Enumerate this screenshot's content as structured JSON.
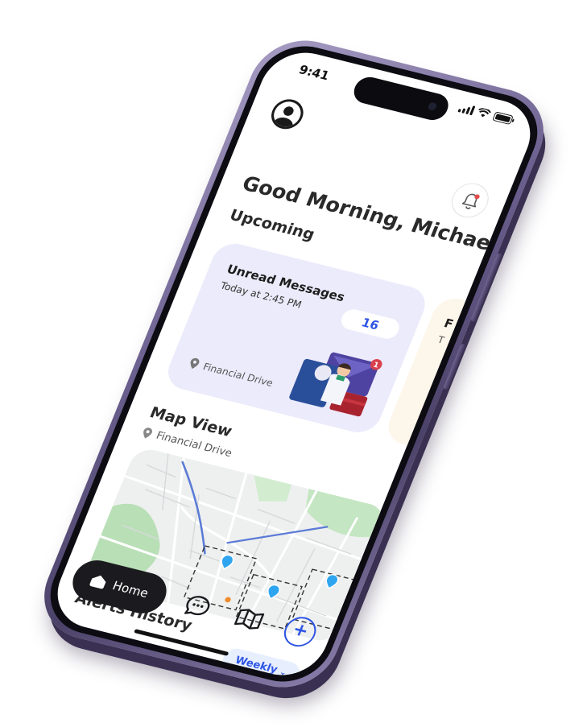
{
  "status_bar": {
    "time": "9:41"
  },
  "header": {
    "greeting": "Good Morning, Michael!",
    "notification_dot_color": "#e34c4c"
  },
  "upcoming": {
    "title": "Upcoming",
    "card": {
      "title": "Unread Messages",
      "time": "Today at 2:45 PM",
      "count": "16",
      "location": "Financial Drive",
      "illustration_badge": "1"
    },
    "peek_card": {
      "title_fragment": "F",
      "subtitle_fragment": "T"
    }
  },
  "map": {
    "title": "Map View",
    "location": "Financial Drive"
  },
  "alerts": {
    "title": "Alerts History",
    "period_select": "Weekly"
  },
  "tab_bar": {
    "home_label": "Home"
  },
  "colors": {
    "accent": "#2f55e4",
    "card_bg": "#ecebfb",
    "phone_frame": "#6a5f8e"
  }
}
